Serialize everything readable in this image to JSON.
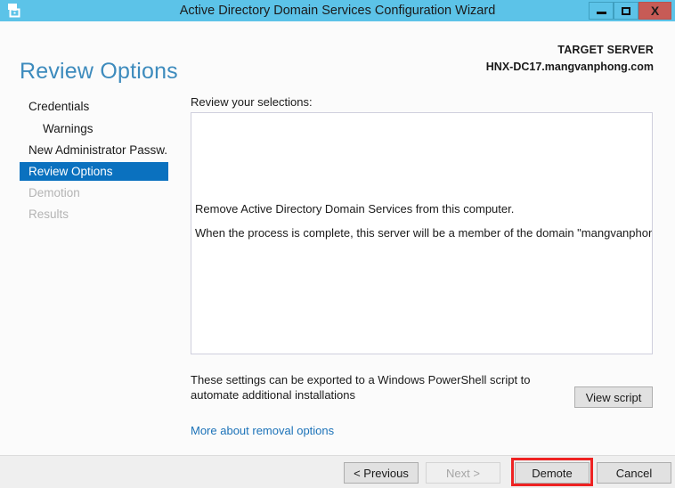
{
  "window": {
    "title": "Active Directory Domain Services Configuration Wizard",
    "icon": "server-wizard-icon",
    "titlebar_color": "#5cc3e8",
    "controls": {
      "minimize": "minimize-icon",
      "maximize": "maximize-icon",
      "close_label": "X",
      "close_color": "#c75b56"
    }
  },
  "header": {
    "page_title": "Review Options",
    "page_title_color": "#3d8bbd",
    "target_server_label": "TARGET SERVER",
    "target_server_name": "HNX-DC17.mangvanphong.com"
  },
  "sidebar": {
    "items": [
      {
        "label": "Credentials",
        "state": "normal",
        "indent": false
      },
      {
        "label": "Warnings",
        "state": "normal",
        "indent": true
      },
      {
        "label": "New Administrator Passw...",
        "state": "normal",
        "indent": false
      },
      {
        "label": "Review Options",
        "state": "selected",
        "indent": false
      },
      {
        "label": "Demotion",
        "state": "disabled",
        "indent": false
      },
      {
        "label": "Results",
        "state": "disabled",
        "indent": false
      }
    ],
    "selected_color": "#0a71bf"
  },
  "main": {
    "selections_label": "Review your selections:",
    "selections": [
      "Remove Active Directory Domain Services from this computer.",
      "When the process is complete, this server will be a member of the domain \"mangvanphong.com\"."
    ],
    "powershell_note": "These settings can be exported to a Windows PowerShell script to automate additional installations",
    "view_script_label": "View script",
    "more_link_label": "More about removal options",
    "link_color": "#1b72b8"
  },
  "footer": {
    "previous_label": "< Previous",
    "next_label": "Next >",
    "next_disabled": true,
    "demote_label": "Demote",
    "cancel_label": "Cancel",
    "highlight_color": "#ee2222"
  }
}
